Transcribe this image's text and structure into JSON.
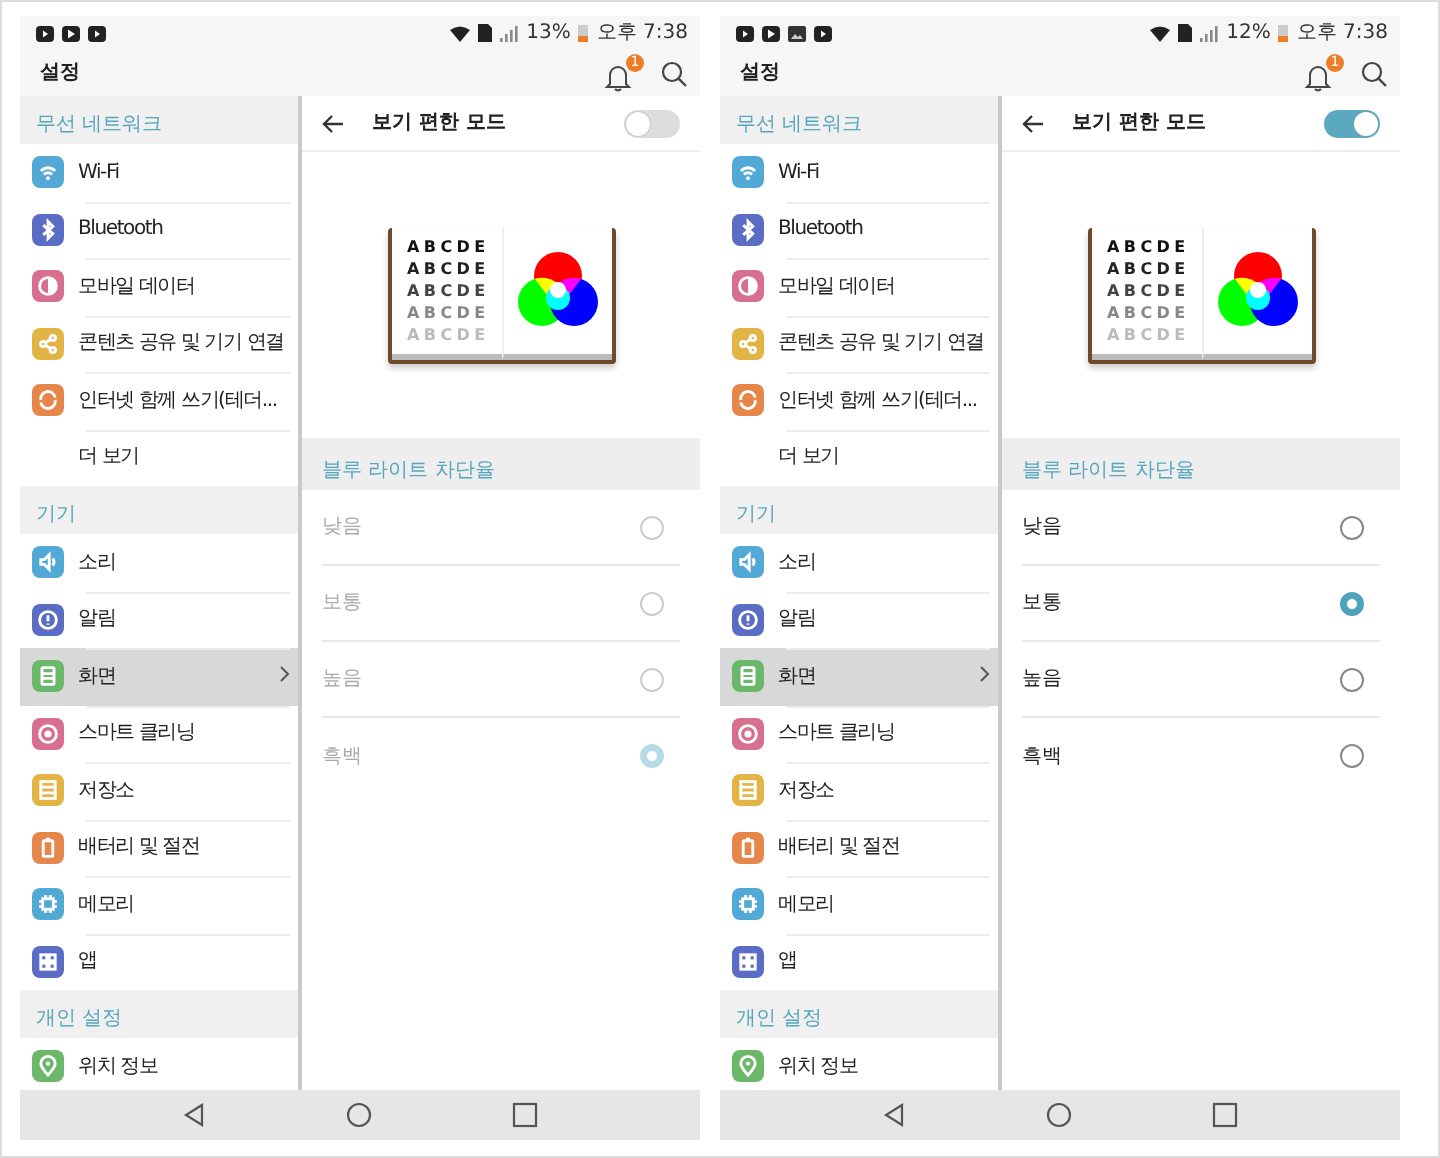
{
  "phones": [
    {
      "status_bar": {
        "notification_icons": [
          {
            "kind": "video"
          },
          {
            "kind": "play"
          },
          {
            "kind": "video"
          }
        ],
        "battery_text": "13%",
        "time": "오후 7:38"
      },
      "app_bar": {
        "title": "설정",
        "notification_count": "1"
      },
      "sidebar": {
        "sections": [
          {
            "header": "무선 네트워크",
            "items": [
              {
                "label": "Wi-Fi",
                "kind": "wifi",
                "color": "#52a9d6",
                "selected": false
              },
              {
                "label": "Bluetooth",
                "kind": "bluetooth",
                "color": "#5b6cc4",
                "selected": false
              },
              {
                "label": "모바일 데이터",
                "kind": "data",
                "color": "#d7708f",
                "selected": false
              },
              {
                "label": "콘텐츠 공유 및 기기 연결",
                "kind": "share",
                "color": "#e2b446",
                "selected": false
              },
              {
                "label": "인터넷 함께 쓰기(테더...",
                "kind": "tether",
                "color": "#e5874a",
                "selected": false
              },
              {
                "label": "더 보기",
                "selected": false
              }
            ]
          },
          {
            "header": "기기",
            "items": [
              {
                "label": "소리",
                "kind": "sound",
                "color": "#52a9d6",
                "selected": false
              },
              {
                "label": "알림",
                "kind": "alert",
                "color": "#5b6cc4",
                "selected": false
              },
              {
                "label": "화면",
                "kind": "display",
                "color": "#6cb86b",
                "selected": true
              },
              {
                "label": "스마트 클리닝",
                "kind": "cleaning",
                "color": "#d7708f",
                "selected": false
              },
              {
                "label": "저장소",
                "kind": "storage",
                "color": "#e2b446",
                "selected": false
              },
              {
                "label": "배터리 및 절전",
                "kind": "battery",
                "color": "#e5874a",
                "selected": false
              },
              {
                "label": "메모리",
                "kind": "memory",
                "color": "#52a9d6",
                "selected": false
              },
              {
                "label": "앱",
                "kind": "apps",
                "color": "#5b6cc4",
                "selected": false
              }
            ]
          },
          {
            "header": "개인 설정",
            "items": [
              {
                "label": "위치 정보",
                "kind": "location",
                "color": "#6cb86b",
                "selected": false
              }
            ]
          }
        ]
      },
      "detail": {
        "title": "보기 편한 모드",
        "on": false,
        "illustration_lines": [
          "ABCDE",
          "ABCDE",
          "ABCDE",
          "ABCDE",
          "ABCDE"
        ],
        "section_label": "블루 라이트 차단율",
        "options": [
          {
            "label": "낮음",
            "selected": false
          },
          {
            "label": "보통",
            "selected": false
          },
          {
            "label": "높음",
            "selected": false
          },
          {
            "label": "흑백",
            "selected": true
          }
        ]
      },
      "nav_bar": {
        "buttons": [
          {
            "kind": "back"
          },
          {
            "kind": "home"
          },
          {
            "kind": "recents"
          }
        ]
      }
    },
    {
      "status_bar": {
        "notification_icons": [
          {
            "kind": "video"
          },
          {
            "kind": "play"
          },
          {
            "kind": "image"
          },
          {
            "kind": "video"
          }
        ],
        "battery_text": "12%",
        "time": "오후 7:38"
      },
      "app_bar": {
        "title": "설정",
        "notification_count": "1"
      },
      "sidebar": {
        "sections": [
          {
            "header": "무선 네트워크",
            "items": [
              {
                "label": "Wi-Fi",
                "kind": "wifi",
                "color": "#52a9d6",
                "selected": false
              },
              {
                "label": "Bluetooth",
                "kind": "bluetooth",
                "color": "#5b6cc4",
                "selected": false
              },
              {
                "label": "모바일 데이터",
                "kind": "data",
                "color": "#d7708f",
                "selected": false
              },
              {
                "label": "콘텐츠 공유 및 기기 연결",
                "kind": "share",
                "color": "#e2b446",
                "selected": false
              },
              {
                "label": "인터넷 함께 쓰기(테더...",
                "kind": "tether",
                "color": "#e5874a",
                "selected": false
              },
              {
                "label": "더 보기",
                "selected": false
              }
            ]
          },
          {
            "header": "기기",
            "items": [
              {
                "label": "소리",
                "kind": "sound",
                "color": "#52a9d6",
                "selected": false
              },
              {
                "label": "알림",
                "kind": "alert",
                "color": "#5b6cc4",
                "selected": false
              },
              {
                "label": "화면",
                "kind": "display",
                "color": "#6cb86b",
                "selected": true
              },
              {
                "label": "스마트 클리닝",
                "kind": "cleaning",
                "color": "#d7708f",
                "selected": false
              },
              {
                "label": "저장소",
                "kind": "storage",
                "color": "#e2b446",
                "selected": false
              },
              {
                "label": "배터리 및 절전",
                "kind": "battery",
                "color": "#e5874a",
                "selected": false
              },
              {
                "label": "메모리",
                "kind": "memory",
                "color": "#52a9d6",
                "selected": false
              },
              {
                "label": "앱",
                "kind": "apps",
                "color": "#5b6cc4",
                "selected": false
              }
            ]
          },
          {
            "header": "개인 설정",
            "items": [
              {
                "label": "위치 정보",
                "kind": "location",
                "color": "#6cb86b",
                "selected": false
              }
            ]
          }
        ]
      },
      "detail": {
        "title": "보기 편한 모드",
        "on": true,
        "illustration_lines": [
          "ABCDE",
          "ABCDE",
          "ABCDE",
          "ABCDE",
          "ABCDE"
        ],
        "section_label": "블루 라이트 차단율",
        "options": [
          {
            "label": "낮음",
            "selected": false
          },
          {
            "label": "보통",
            "selected": true
          },
          {
            "label": "높음",
            "selected": false
          },
          {
            "label": "흑백",
            "selected": false
          }
        ]
      },
      "nav_bar": {
        "buttons": [
          {
            "kind": "back"
          },
          {
            "kind": "home"
          },
          {
            "kind": "recents"
          }
        ]
      }
    }
  ]
}
